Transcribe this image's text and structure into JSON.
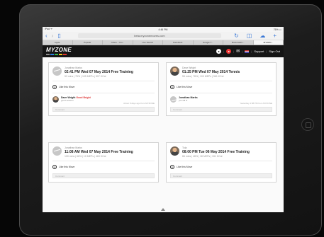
{
  "browser": {
    "status_left": "iPad ᯤ",
    "status_time": "4:46 PM",
    "status_right": "76% ▭",
    "url": "beta.myzonemoves.com",
    "tabs": [
      "Apple",
      "Popular",
      "Yahoo - You...",
      "Live Search",
      "Facebook",
      "Google T...",
      "Bookmarks...",
      "MYZON..."
    ]
  },
  "header": {
    "logo": "MYZONE",
    "logo_colors": [
      "#8c8c8c",
      "#2a7de1",
      "#2fb54a",
      "#f2c21b",
      "#e0332d"
    ],
    "support": "Support",
    "signout": "Sign Out",
    "sep": "|"
  },
  "cards": [
    {
      "name": "Jonathan Marks",
      "title": "02:41 PM Wed 07 May 2014 Free Training",
      "stats": "53 mins | 75% | 105 MEPs | 597 KCal",
      "like": "Like this Move",
      "comment_name": "Dave Wright",
      "comment_tag": "Good Bright",
      "comment_text": "good session",
      "comment_time": "About 8 days ago from MYZONE",
      "comment_placeholder": "Comment"
    },
    {
      "name": "Dave Wright",
      "title": "01:25 PM Wed 07 May 2014 Tennis",
      "stats": "55 mins | 78% | 109 MEPs | 561 KCal",
      "like": "Like this Move",
      "comment_name": "Jonathan Marks",
      "comment_tag": "",
      "comment_text": "you kill it!",
      "comment_time": "Yesterday 4:58 PM from MYZONE",
      "comment_placeholder": "Comment"
    },
    {
      "name": "Jonathan Marks",
      "title": "11:08 AM Wed 07 May 2014 Free Training",
      "stats": "100 mins | 66% | 10 MEPs | 469 KCal",
      "like": "Like this Move",
      "comment_placeholder": "Comment"
    },
    {
      "name": "Tola",
      "title": "08:00 PM Tue 06 May 2014 Free Training",
      "stats": "86 mins | 48% | 18 MEPs | 151 KCal",
      "like": "Like this Move",
      "comment_placeholder": "Comment"
    }
  ]
}
